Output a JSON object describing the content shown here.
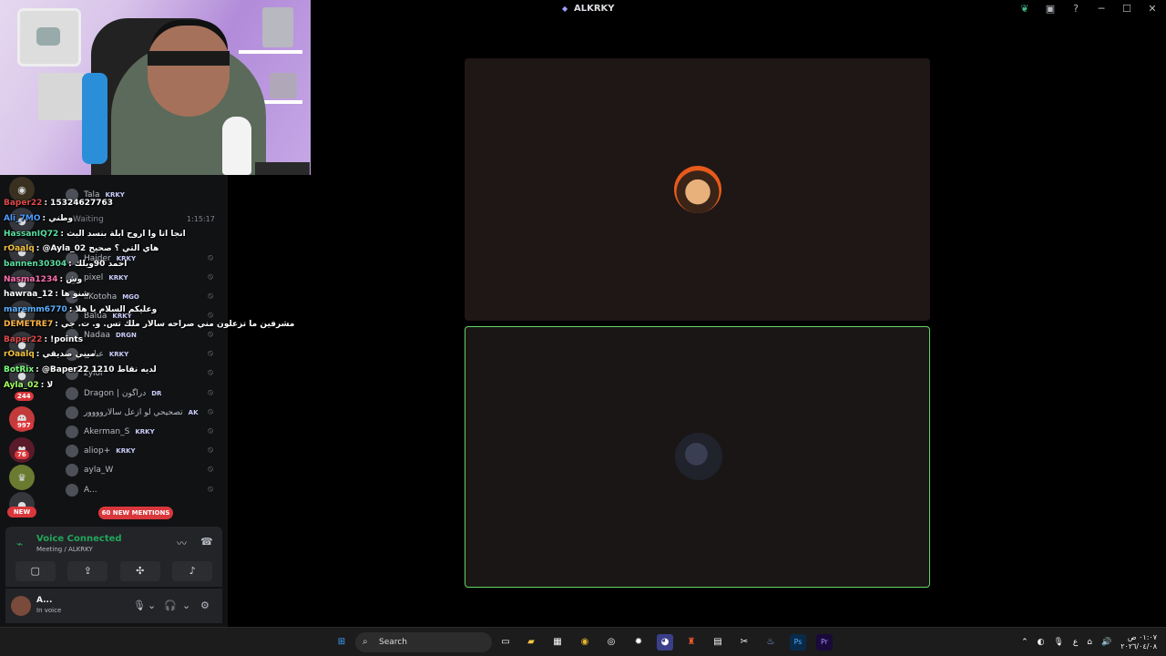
{
  "window": {
    "title": "ALKRKY"
  },
  "members_header": {
    "waiting_label": "Waiting",
    "waiting_time": "1:15:17"
  },
  "members": [
    {
      "name": "Tala",
      "tag": "KRKY"
    },
    {
      "name": "Haider",
      "tag": "KRKY"
    },
    {
      "name": "pixel",
      "tag": "KRKY"
    },
    {
      "name": "iiKotoha",
      "tag": "MGO"
    },
    {
      "name": "Balua",
      "tag": "KRKY"
    },
    {
      "name": "Nadaa",
      "tag": "DRGN"
    },
    {
      "name": "عباس",
      "tag": "KRKY"
    },
    {
      "name": "zylor",
      "tag": ""
    },
    {
      "name": "Dragon | دراگون",
      "tag": "DR"
    },
    {
      "name": "تصحيحي لو ازعل سالاروووور",
      "tag": "AK"
    },
    {
      "name": "Akerman_S",
      "tag": "KRKY"
    },
    {
      "name": "aliop+",
      "tag": "KRKY"
    },
    {
      "name": "ayla_W",
      "tag": ""
    },
    {
      "name": "A...",
      "tag": ""
    }
  ],
  "chat": [
    {
      "user": "Baper22",
      "color": "#e04a4a",
      "message": ": 15324627763"
    },
    {
      "user": "Ali_7MO",
      "color": "#4a9cff",
      "message": ": وطني"
    },
    {
      "user": "HassanIQ72",
      "color": "#59e0a0",
      "message": ": انجا اتا وا اروح ابلة بنسد البث"
    },
    {
      "user": "rOaalq",
      "color": "#f0c040",
      "message": ": @Ayla_02 هاي التي ؟ صحيح"
    },
    {
      "user": "bannen30304",
      "color": "#59e0a0",
      "message": ": احمد 90ويلك"
    },
    {
      "user": "Nasma1234",
      "color": "#ff6eb0",
      "message": ": وش"
    },
    {
      "user": "hawraa_12",
      "color": "#ffffff",
      "message": ": شنو ها"
    },
    {
      "user": "maremm6770",
      "color": "#59b0ff",
      "message": ": وعليكم السلام يا هلا"
    },
    {
      "user": "DEMETRE7",
      "color": "#ffb347",
      "message": ": مشرفين ما تزعلون مني صراحه سالار ملك تس. و. ت. جي"
    },
    {
      "user": "Baper22",
      "color": "#e04a4a",
      "message": ": !points"
    },
    {
      "user": "rOaalq",
      "color": "#f0c040",
      "message": ": ميني صديقي"
    },
    {
      "user": "BotRix",
      "color": "#7cff7c",
      "message": ": @Baper22 لديه نقاط 1210"
    },
    {
      "user": "Ayla_02",
      "color": "#a0ff60",
      "message": ": لا"
    }
  ],
  "guild_badges": [
    "244",
    "997",
    "76"
  ],
  "new_label": "NEW",
  "mentions_label": "60 NEW MENTIONS",
  "voice": {
    "status": "Voice Connected",
    "channel": "Meeting / ALKRKY"
  },
  "user": {
    "name": "A...",
    "status": "In voice"
  },
  "taskbar": {
    "search_placeholder": "Search",
    "lang": "ع",
    "time": "٠١:٠٧ ص",
    "date": "٢٠٢٦/٠٤/٠٨"
  }
}
